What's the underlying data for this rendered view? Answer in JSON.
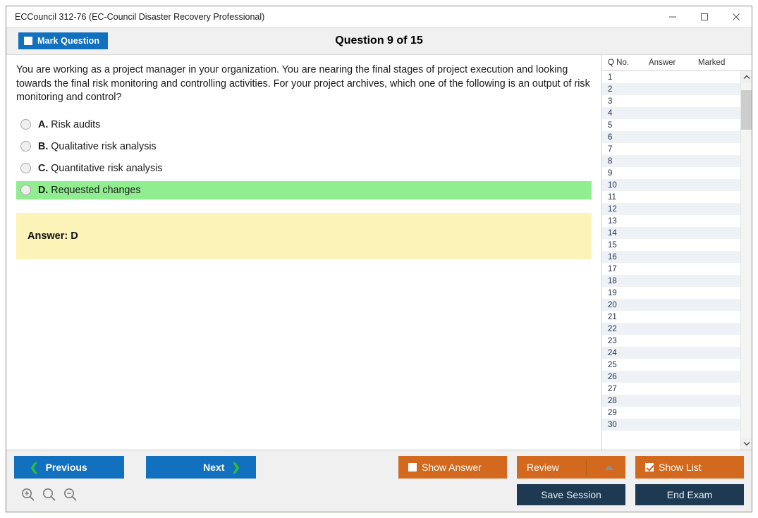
{
  "window": {
    "title": "ECCouncil 312-76 (EC-Council Disaster Recovery Professional)",
    "minimize_label": "minimize",
    "maximize_label": "maximize",
    "close_label": "close"
  },
  "header": {
    "mark_question_label": "Mark Question",
    "mark_question_checked": false,
    "question_counter": "Question 9 of 15"
  },
  "question": {
    "text": "You are working as a project manager in your organization. You are nearing the final stages of project execution and looking towards the final risk monitoring and controlling activities. For your project archives, which one of the following is an output of risk monitoring and control?",
    "options": [
      {
        "letter": "A.",
        "text": "Risk audits",
        "selected": false,
        "correct": false
      },
      {
        "letter": "B.",
        "text": "Qualitative risk analysis",
        "selected": false,
        "correct": false
      },
      {
        "letter": "C.",
        "text": "Quantitative risk analysis",
        "selected": false,
        "correct": false
      },
      {
        "letter": "D.",
        "text": "Requested changes",
        "selected": false,
        "correct": true
      }
    ],
    "answer_label": "Answer: D"
  },
  "question_list": {
    "columns": [
      "Q No.",
      "Answer",
      "Marked"
    ],
    "rows": [
      {
        "no": "1",
        "answer": "",
        "marked": ""
      },
      {
        "no": "2",
        "answer": "",
        "marked": ""
      },
      {
        "no": "3",
        "answer": "",
        "marked": ""
      },
      {
        "no": "4",
        "answer": "",
        "marked": ""
      },
      {
        "no": "5",
        "answer": "",
        "marked": ""
      },
      {
        "no": "6",
        "answer": "",
        "marked": ""
      },
      {
        "no": "7",
        "answer": "",
        "marked": ""
      },
      {
        "no": "8",
        "answer": "",
        "marked": ""
      },
      {
        "no": "9",
        "answer": "",
        "marked": ""
      },
      {
        "no": "10",
        "answer": "",
        "marked": ""
      },
      {
        "no": "11",
        "answer": "",
        "marked": ""
      },
      {
        "no": "12",
        "answer": "",
        "marked": ""
      },
      {
        "no": "13",
        "answer": "",
        "marked": ""
      },
      {
        "no": "14",
        "answer": "",
        "marked": ""
      },
      {
        "no": "15",
        "answer": "",
        "marked": ""
      },
      {
        "no": "16",
        "answer": "",
        "marked": ""
      },
      {
        "no": "17",
        "answer": "",
        "marked": ""
      },
      {
        "no": "18",
        "answer": "",
        "marked": ""
      },
      {
        "no": "19",
        "answer": "",
        "marked": ""
      },
      {
        "no": "20",
        "answer": "",
        "marked": ""
      },
      {
        "no": "21",
        "answer": "",
        "marked": ""
      },
      {
        "no": "22",
        "answer": "",
        "marked": ""
      },
      {
        "no": "23",
        "answer": "",
        "marked": ""
      },
      {
        "no": "24",
        "answer": "",
        "marked": ""
      },
      {
        "no": "25",
        "answer": "",
        "marked": ""
      },
      {
        "no": "26",
        "answer": "",
        "marked": ""
      },
      {
        "no": "27",
        "answer": "",
        "marked": ""
      },
      {
        "no": "28",
        "answer": "",
        "marked": ""
      },
      {
        "no": "29",
        "answer": "",
        "marked": ""
      },
      {
        "no": "30",
        "answer": "",
        "marked": ""
      }
    ]
  },
  "toolbar": {
    "previous_label": "Previous",
    "next_label": "Next",
    "show_answer_label": "Show Answer",
    "show_answer_checked": false,
    "review_label": "Review",
    "show_list_label": "Show List",
    "show_list_checked": true,
    "save_session_label": "Save Session",
    "end_exam_label": "End Exam",
    "zoom_in_label": "zoom-in",
    "zoom_reset_label": "zoom-reset",
    "zoom_out_label": "zoom-out"
  },
  "colors": {
    "primary_blue": "#1271bf",
    "orange": "#d2691e",
    "navy": "#1e3a52",
    "correct_green": "#90ee90",
    "answer_yellow": "#fcf3b8",
    "chevron_green": "#2fc02f"
  }
}
